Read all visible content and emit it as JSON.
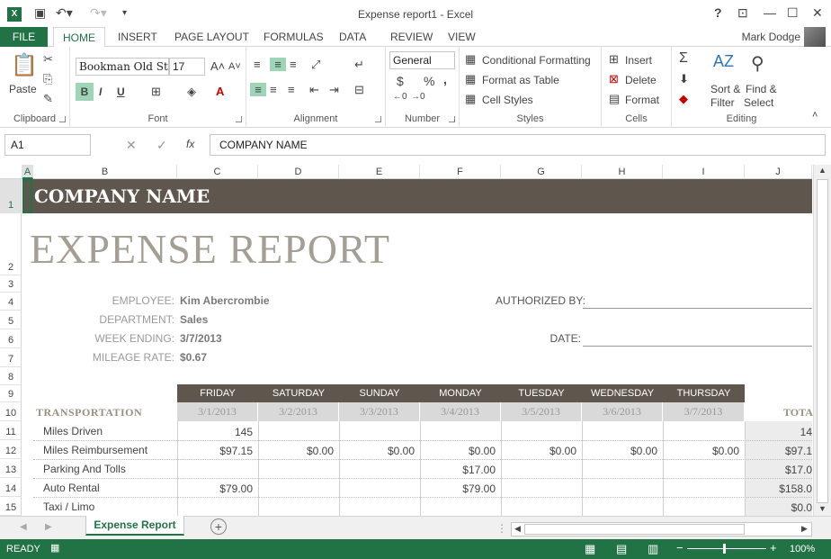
{
  "titlebar": {
    "title": "Expense report1 - Excel",
    "app_icon": "X",
    "help": "?",
    "restore": "⊡",
    "minimize": "—",
    "maximize": "☐",
    "close": "✕"
  },
  "tabs": {
    "file": "FILE",
    "home": "HOME",
    "insert": "INSERT",
    "page_layout": "PAGE LAYOUT",
    "formulas": "FORMULAS",
    "data": "DATA",
    "review": "REVIEW",
    "view": "VIEW",
    "user": "Mark Dodge"
  },
  "ribbon": {
    "clipboard": {
      "paste": "Paste",
      "label": "Clipboard"
    },
    "font": {
      "name": "Bookman Old Sty",
      "size": "17",
      "label": "Font",
      "bold": "B",
      "italic": "I",
      "underline": "U"
    },
    "alignment": {
      "label": "Alignment"
    },
    "number": {
      "format": "General",
      "currency": "$",
      "percent": "%",
      "comma": ",",
      "label": "Number"
    },
    "styles": {
      "conditional": "Conditional Formatting",
      "table": "Format as Table",
      "cell_styles": "Cell Styles",
      "label": "Styles"
    },
    "cells": {
      "insert": "Insert",
      "delete": "Delete",
      "format": "Format",
      "label": "Cells"
    },
    "editing": {
      "sort": "Sort &",
      "filter": "Filter",
      "find": "Find &",
      "select": "Select",
      "label": "Editing"
    }
  },
  "formula_bar": {
    "name_box": "A1",
    "fx": "fx",
    "content": "COMPANY NAME"
  },
  "columns": [
    "A",
    "B",
    "C",
    "D",
    "E",
    "F",
    "G",
    "H",
    "I",
    "J"
  ],
  "rows": [
    "1",
    "2",
    "3",
    "4",
    "5",
    "6",
    "7",
    "8",
    "9",
    "10",
    "11",
    "12",
    "13",
    "14",
    "15"
  ],
  "sheet": {
    "company": "COMPANY NAME",
    "report": "EXPENSE REPORT",
    "employee_label": "EMPLOYEE:",
    "employee": "Kim Abercrombie",
    "department_label": "DEPARTMENT:",
    "department": "Sales",
    "week_label": "WEEK ENDING:",
    "week": "3/7/2013",
    "mileage_label": "MILEAGE RATE:",
    "mileage": "$0.67",
    "authorized_label": "AUTHORIZED BY:",
    "date_label": "DATE:",
    "transportation": "TRANSPORTATION",
    "total": "TOTA",
    "days": [
      "FRIDAY",
      "SATURDAY",
      "SUNDAY",
      "MONDAY",
      "TUESDAY",
      "WEDNESDAY",
      "THURSDAY"
    ],
    "dates": [
      "3/1/2013",
      "3/2/2013",
      "3/3/2013",
      "3/4/2013",
      "3/5/2013",
      "3/6/2013",
      "3/7/2013"
    ],
    "items": [
      {
        "name": "Miles Driven",
        "values": [
          "145",
          "",
          "",
          "",
          "",
          "",
          ""
        ],
        "total": "14"
      },
      {
        "name": "Miles Reimbursement",
        "values": [
          "$97.15",
          "$0.00",
          "$0.00",
          "$0.00",
          "$0.00",
          "$0.00",
          "$0.00"
        ],
        "total": "$97.1"
      },
      {
        "name": "Parking And Tolls",
        "values": [
          "",
          "",
          "",
          "$17.00",
          "",
          "",
          ""
        ],
        "total": "$17.0"
      },
      {
        "name": "Auto Rental",
        "values": [
          "$79.00",
          "",
          "",
          "$79.00",
          "",
          "",
          ""
        ],
        "total": "$158.0"
      },
      {
        "name": "Taxi / Limo",
        "values": [
          "",
          "",
          "",
          "",
          "",
          "",
          ""
        ],
        "total": "$0.0"
      }
    ]
  },
  "sheet_tabs": {
    "active": "Expense Report",
    "add": "+"
  },
  "status": {
    "ready": "READY",
    "zoom": "100%"
  }
}
